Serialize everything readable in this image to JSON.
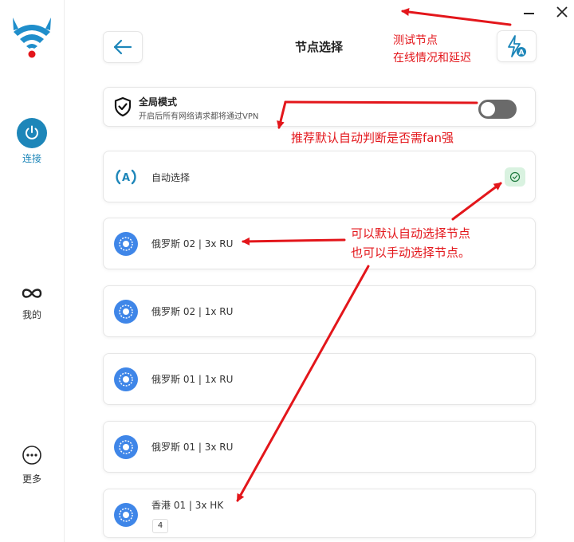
{
  "header": {
    "title": "节点选择"
  },
  "sidebar": {
    "items": [
      {
        "label": "连接",
        "icon": "power-icon"
      },
      {
        "label": "我的",
        "icon": "infinity-icon"
      },
      {
        "label": "更多",
        "icon": "more-icon"
      }
    ]
  },
  "global_mode": {
    "title": "全局模式",
    "subtitle": "开启后所有网络请求都将通过VPN",
    "enabled": false
  },
  "auto_select": {
    "label": "自动选择",
    "selected": true
  },
  "nodes": [
    {
      "label": "俄罗斯 02 | 3x RU"
    },
    {
      "label": "俄罗斯 02 | 1x RU"
    },
    {
      "label": "俄罗斯 01 | 1x RU"
    },
    {
      "label": "俄罗斯 01 | 3x RU"
    },
    {
      "label": "香港 01 | 3x HK",
      "badge": "4"
    }
  ],
  "annotations": {
    "test_line1": "测试节点",
    "test_line2": "在线情况和延迟",
    "global": "推荐默认自动判断是否需fan强",
    "select_line1": "可以默认自动选择节点",
    "select_line2": "也可以手动选择节点。"
  },
  "colors": {
    "accent": "#1d86b9",
    "node_icon": "#3f86e8",
    "annotation": "#e3161b",
    "toggle_off": "#6a6a6a",
    "check_bg": "#d9f2e0"
  }
}
